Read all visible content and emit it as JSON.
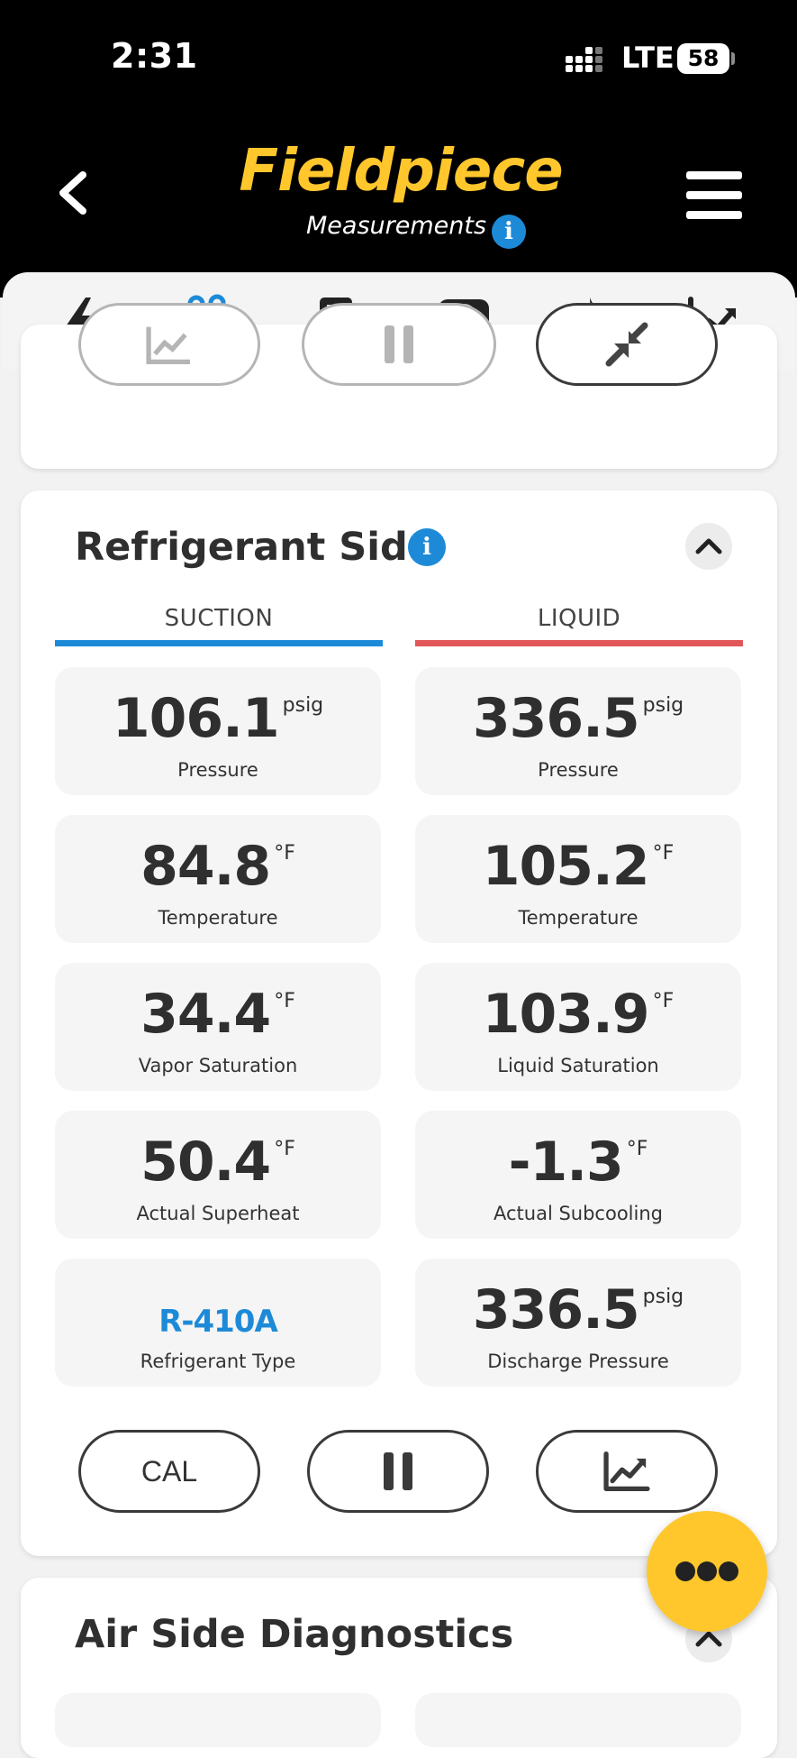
{
  "status_bar": {
    "time": "2:31",
    "network": "LTE",
    "battery": "58"
  },
  "header": {
    "logo": "Fieldpiece",
    "subtitle": "Measurements",
    "info_icon": "i"
  },
  "tabs": [
    {
      "name": "electrical",
      "active": false
    },
    {
      "name": "temperature",
      "active": true
    },
    {
      "name": "manifold",
      "active": false
    },
    {
      "name": "gauge",
      "active": false
    },
    {
      "name": "combustion",
      "active": false
    },
    {
      "name": "trends",
      "active": false
    }
  ],
  "refrigerant": {
    "title": "Refrigerant Side",
    "suction": {
      "label": "SUCTION",
      "color": "#1d8ad8",
      "tiles": [
        {
          "value": "106.1",
          "unit": "psig",
          "label": "Pressure"
        },
        {
          "value": "84.8",
          "unit": "°F",
          "label": "Temperature"
        },
        {
          "value": "34.4",
          "unit": "°F",
          "label": "Vapor Saturation"
        },
        {
          "value": "50.4",
          "unit": "°F",
          "label": "Actual Superheat"
        },
        {
          "value": "R-410A",
          "unit": "",
          "label": "Refrigerant Type"
        }
      ]
    },
    "liquid": {
      "label": "LIQUID",
      "color": "#e15759",
      "tiles": [
        {
          "value": "336.5",
          "unit": "psig",
          "label": "Pressure"
        },
        {
          "value": "105.2",
          "unit": "°F",
          "label": "Temperature"
        },
        {
          "value": "103.9",
          "unit": "°F",
          "label": "Liquid Saturation"
        },
        {
          "value": "-1.3",
          "unit": "°F",
          "label": "Actual Subcooling"
        },
        {
          "value": "336.5",
          "unit": "psig",
          "label": "Discharge Pressure"
        }
      ]
    },
    "buttons": {
      "cal": "CAL"
    }
  },
  "air_side": {
    "title": "Air Side Diagnostics"
  },
  "colors": {
    "brand_yellow": "#ffc72c",
    "accent_blue": "#1d8ad8",
    "liquid_red": "#e15759"
  }
}
